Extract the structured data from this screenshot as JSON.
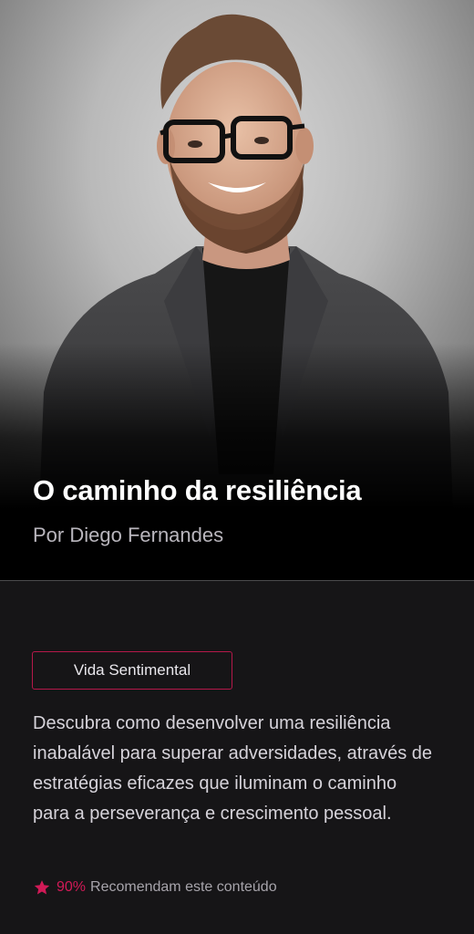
{
  "hero": {
    "title": "O caminho da resiliência",
    "author": "Por Diego Fernandes"
  },
  "details": {
    "category_tag": "Vida Sentimental",
    "description": "Descubra como desenvolver uma resiliência inabalável para superar adversidades, através de estratégias eficazes que iluminam o caminho para a perseverança e crescimento pessoal.",
    "recommendation": {
      "icon": "star-icon",
      "percent": "90%",
      "label": "Recomendam este conteúdo"
    }
  },
  "colors": {
    "accent": "#d11a57",
    "background": "#161517",
    "hero_background": "#000000"
  }
}
